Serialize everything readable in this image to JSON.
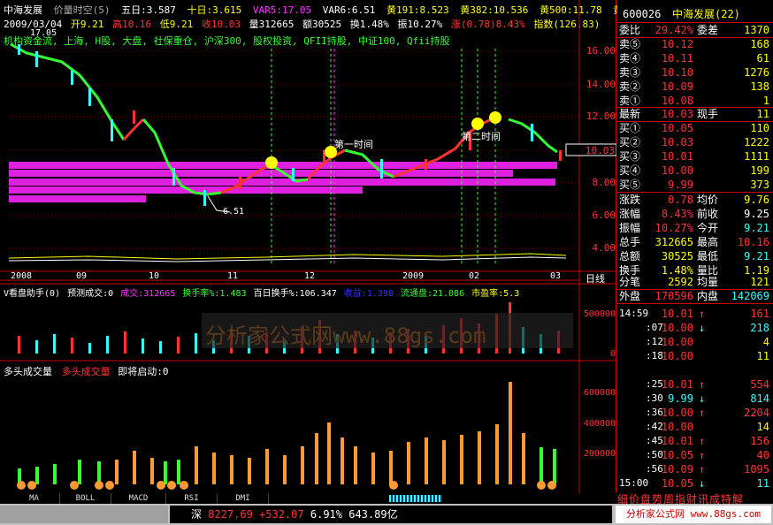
{
  "header": {
    "stock_name": "中海发展",
    "mode": "价量时空(5)",
    "ma5": "五日:3.587",
    "ma10": "十日:3.615",
    "var5": "VAR5:17.05",
    "var6": "VAR6:6.51",
    "yellow191": "黄191:8.523",
    "yellow382": "黄382:10.536",
    "yellow500": "黄500:11.78",
    "yellow618": "黄61"
  },
  "header2": {
    "date": "2009/03/04",
    "open": "开9.21",
    "high": "高10.16",
    "low": "低9.21",
    "close": "收10.03",
    "vol": "量312665",
    "amt": "额30525",
    "turnover": "换1.48%",
    "amp": "振10.27%",
    "chg": "涨(0.78)8.43%",
    "idx": "指数(126.83)"
  },
  "header3": "机构资金流, 上海, H股, 大盘, 社保重仓, 沪深300, 股权投资, QFII持股, 中证100, Qfii持股",
  "price_axis": [
    "16.00",
    "14.00",
    "12.00",
    "10.00",
    "8.00",
    "6.00",
    "4.00"
  ],
  "price_label_current": "10.03",
  "price_annot_high": "17.05",
  "price_annot_low": "6.51",
  "time_annot_1": "第一时间",
  "time_annot_2": "第二时间",
  "date_labels": [
    "2008",
    "09",
    "10",
    "11",
    "12",
    "2009",
    "02",
    "03"
  ],
  "date_axis_title": "日线",
  "panel2_header": {
    "name": "V看盘助手(0)",
    "pred": "预测成交:0",
    "vol": "成交:312665",
    "turn": "换手率%:1.483",
    "hundred": "百日换手%:106.347",
    "profit": "收益:1.398",
    "float": "流通盘:21.086",
    "pe": "市盈率:5.3"
  },
  "panel2_axis": [
    "500000",
    "0"
  ],
  "panel3_header": {
    "name": "多头成交量",
    "sub": "多头成交量",
    "start": "即将启动:0"
  },
  "panel3_axis": [
    "600000",
    "400000",
    "200000"
  ],
  "watermark": "分析家公式网www.88gs.com",
  "tabs": [
    "MA",
    "BOLL",
    "MACD",
    "RSI",
    "DMI"
  ],
  "status": {
    "index_name": "深",
    "index_value": "8227.69",
    "index_chg": "+532.07",
    "index_pct": "6.91%",
    "index_amt": "643.89亿",
    "site": "分析家公式网 www.88gs.com"
  },
  "quote": {
    "code": "600026",
    "name": "中海发展(22)",
    "weibi_label": "委比",
    "weibi": "29.42%",
    "weicha_label": "委差",
    "weicha": "1370",
    "sells": [
      {
        "label": "卖⑤",
        "price": "10.12",
        "vol": "168"
      },
      {
        "label": "卖④",
        "price": "10.11",
        "vol": "61"
      },
      {
        "label": "卖③",
        "price": "10.10",
        "vol": "1276"
      },
      {
        "label": "卖②",
        "price": "10.09",
        "vol": "138"
      },
      {
        "label": "卖①",
        "price": "10.08",
        "vol": "1"
      }
    ],
    "latest_label": "最新",
    "latest": "10.03",
    "xianshou_label": "现手",
    "xianshou": "11",
    "buys": [
      {
        "label": "买①",
        "price": "10.05",
        "vol": "110"
      },
      {
        "label": "买②",
        "price": "10.03",
        "vol": "1222"
      },
      {
        "label": "买③",
        "price": "10.01",
        "vol": "1111"
      },
      {
        "label": "买④",
        "price": "10.00",
        "vol": "199"
      },
      {
        "label": "买⑤",
        "price": "9.99",
        "vol": "373"
      }
    ],
    "stats": [
      {
        "l1": "涨跌",
        "v1": "0.78",
        "l2": "均价",
        "v2": "9.76"
      },
      {
        "l1": "涨幅",
        "v1": "8.43%",
        "l2": "前收",
        "v2": "9.25"
      },
      {
        "l1": "振幅",
        "v1": "10.27%",
        "l2": "今开",
        "v2": "9.21"
      },
      {
        "l1": "总手",
        "v1": "312665",
        "l2": "最高",
        "v2": "10.16"
      },
      {
        "l1": "总额",
        "v1": "30525",
        "l2": "最低",
        "v2": "9.21"
      },
      {
        "l1": "换手",
        "v1": "1.48%",
        "l2": "量比",
        "v2": "1.19"
      },
      {
        "l1": "分笔",
        "v1": "2592",
        "l2": "均量",
        "v2": "121"
      }
    ],
    "waipan_label": "外盘",
    "waipan": "170596",
    "neipan_label": "内盘",
    "neipan": "142069",
    "ticks": [
      {
        "t": "14:59",
        "p": "10.01",
        "d": "↑",
        "v": "161"
      },
      {
        "t": ":07",
        "p": "10.00",
        "d": "↓",
        "v": "218"
      },
      {
        "t": ":12",
        "p": "10.00",
        "d": "",
        "v": "4"
      },
      {
        "t": ":18",
        "p": "10.00",
        "d": "",
        "v": "11"
      },
      {
        "t": ":25",
        "p": "10.01",
        "d": "↑",
        "v": "554"
      },
      {
        "t": ":30",
        "p": "9.99",
        "d": "↓",
        "v": "814"
      },
      {
        "t": ":36",
        "p": "10.00",
        "d": "↑",
        "v": "2204"
      },
      {
        "t": ":42",
        "p": "10.00",
        "d": "",
        "v": "14"
      },
      {
        "t": ":45",
        "p": "10.01",
        "d": "↑",
        "v": "156"
      },
      {
        "t": ":50",
        "p": "10.05",
        "d": "↑",
        "v": "40"
      },
      {
        "t": ":56",
        "p": "10.09",
        "d": "↑",
        "v": "1095"
      },
      {
        "t": "15:00",
        "p": "10.05",
        "d": "↓",
        "v": "11"
      }
    ],
    "bottom_tabs": "细价盘势周指财讯成特解"
  },
  "colors": {
    "up": "#ff3333",
    "down": "#33ffff",
    "ma_green": "#33ff33",
    "magenta": "#ff33ff",
    "axis_red": "#cc0000"
  }
}
